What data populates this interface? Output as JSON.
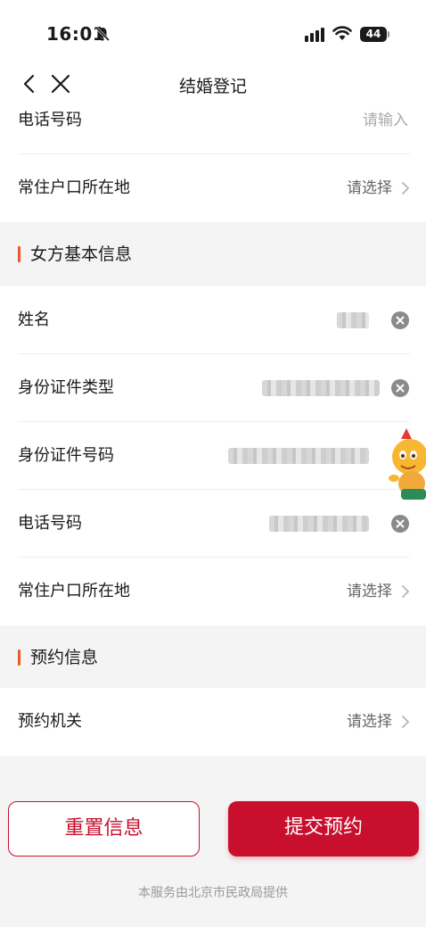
{
  "status_bar": {
    "time": "16:01",
    "battery": "44"
  },
  "nav": {
    "title": "结婚登记"
  },
  "section_partial": {
    "phone_label": "电话号码",
    "phone_placeholder": "请输入",
    "residence_label": "常住户口所在地",
    "residence_value": "请选择"
  },
  "female_section": {
    "title": "女方基本信息",
    "name_label": "姓名",
    "id_type_label": "身份证件类型",
    "id_number_label": "身份证件号码",
    "phone_label": "电话号码",
    "residence_label": "常住户口所在地",
    "residence_value": "请选择"
  },
  "appointment_section": {
    "title": "预约信息",
    "office_label": "预约机关",
    "office_value": "请选择"
  },
  "actions": {
    "reset_label": "重置信息",
    "submit_label": "提交预约"
  },
  "footer": {
    "text": "本服务由北京市民政局提供"
  },
  "colors": {
    "accent": "#c8102e",
    "section_bar": "#ee5a24",
    "background": "#f4f4f4"
  }
}
